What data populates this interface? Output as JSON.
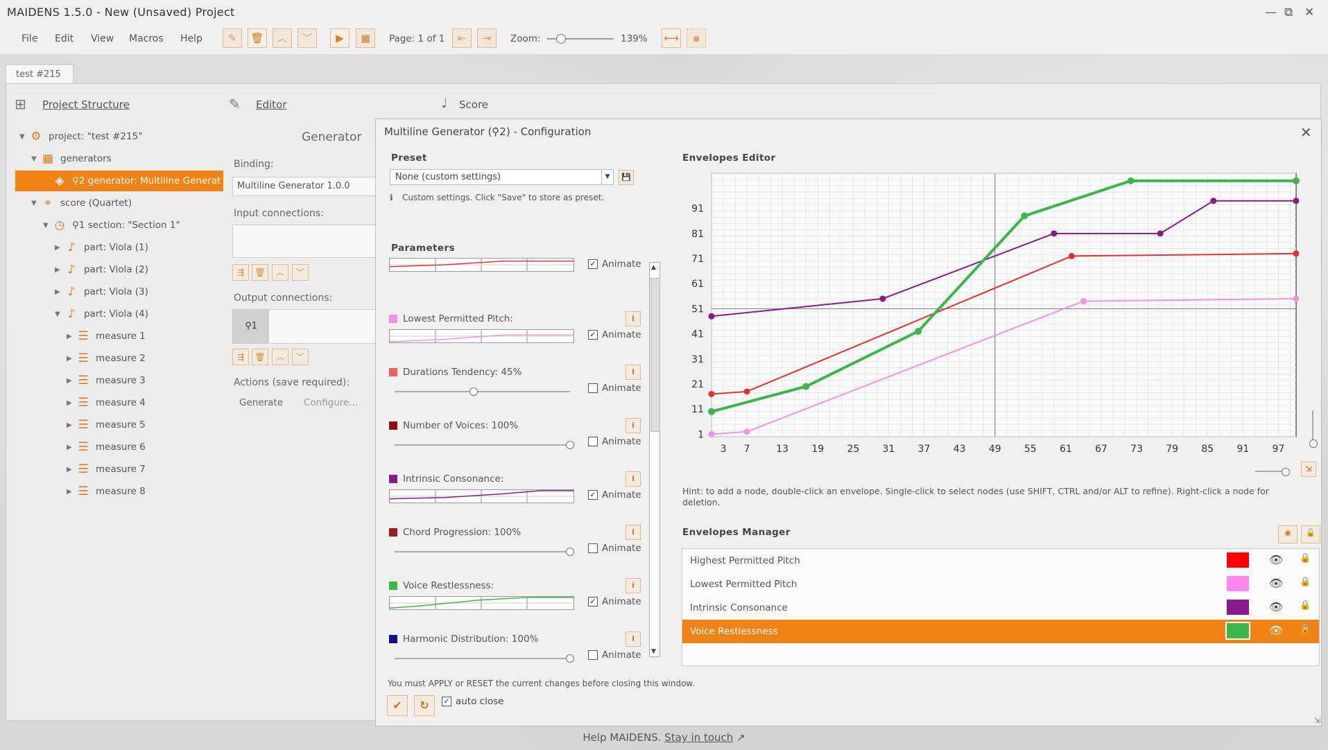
{
  "window": {
    "title": "MAIDENS 1.5.0 - New (Unsaved) Project"
  },
  "menu": [
    "File",
    "Edit",
    "View",
    "Macros",
    "Help"
  ],
  "toolbar": {
    "page_label": "Page: 1 of 1",
    "zoom_label": "Zoom:",
    "zoom_value": "139%",
    "zoom_level": 0.2
  },
  "tab": {
    "label": "test #215"
  },
  "panels": {
    "project_structure": "Project Structure",
    "editor": "Editor",
    "score": "Score"
  },
  "tree": [
    {
      "label": "project: \"test #215\"",
      "icon": "project-icon",
      "level": 0,
      "expand": "▼"
    },
    {
      "label": "generators",
      "icon": "generators-icon",
      "level": 1,
      "expand": "▼"
    },
    {
      "label": "⚲2 generator: Multiline Generat",
      "icon": "generator-icon",
      "level": 2,
      "expand": "",
      "selected": true
    },
    {
      "label": "score (Quartet)",
      "icon": "score-icon",
      "level": 1,
      "expand": "▼"
    },
    {
      "label": "⚲1 section: \"Section 1\"",
      "icon": "section-icon",
      "level": 2,
      "expand": "▼"
    },
    {
      "label": "part: Viola (1)",
      "icon": "viola-icon",
      "level": 3,
      "expand": "▶"
    },
    {
      "label": "part: Viola (2)",
      "icon": "viola-icon",
      "level": 3,
      "expand": "▶"
    },
    {
      "label": "part: Viola (3)",
      "icon": "viola-icon",
      "level": 3,
      "expand": "▶"
    },
    {
      "label": "part: Viola (4)",
      "icon": "viola-icon",
      "level": 3,
      "expand": "▼"
    },
    {
      "label": "measure 1",
      "icon": "measure-icon",
      "level": 4,
      "expand": "▶"
    },
    {
      "label": "measure 2",
      "icon": "measure-icon",
      "level": 4,
      "expand": "▶"
    },
    {
      "label": "measure 3",
      "icon": "measure-icon",
      "level": 4,
      "expand": "▶"
    },
    {
      "label": "measure 4",
      "icon": "measure-icon",
      "level": 4,
      "expand": "▶"
    },
    {
      "label": "measure 5",
      "icon": "measure-icon",
      "level": 4,
      "expand": "▶"
    },
    {
      "label": "measure 6",
      "icon": "measure-icon",
      "level": 4,
      "expand": "▶"
    },
    {
      "label": "measure 7",
      "icon": "measure-icon",
      "level": 4,
      "expand": "▶"
    },
    {
      "label": "measure 8",
      "icon": "measure-icon",
      "level": 4,
      "expand": "▶"
    }
  ],
  "generator": {
    "title": "Generator",
    "binding_label": "Binding:",
    "binding_value": "Multiline Generator 1.0.0",
    "input_label": "Input connections:",
    "output_label": "Output connections:",
    "output_item": "⚲1",
    "actions_label": "Actions (save required):",
    "generate": "Generate",
    "configure": "Configure..."
  },
  "dialog": {
    "title": "Multiline Generator (⚲2) - Configuration",
    "preset_heading": "Preset",
    "preset_value": "None (custom settings)",
    "preset_hint": "Custom settings. Click \"Save\" to store as preset.",
    "parameters_heading": "Parameters",
    "animate_label": "Animate",
    "envelopes_editor_heading": "Envelopes Editor",
    "editor_hint": "Hint: to add a node, double-click an envelope. Single-click to select nodes (use SHIFT, CTRL and/or ALT to refine). Right-click a node for deletion.",
    "envelopes_manager_heading": "Envelopes Manager",
    "apply_warning": "You must APPLY or RESET the current changes before closing this window.",
    "auto_close": "auto close"
  },
  "parameters": [
    {
      "label": "",
      "color": "",
      "kind": "envelope",
      "env_color": "#e83030",
      "animate": true
    },
    {
      "label": "Lowest Permitted Pitch:",
      "color": "#f590e6",
      "kind": "envelope",
      "env_color": "#f590e6",
      "animate": true
    },
    {
      "label": "Durations Tendency:   45%",
      "color": "#f46060",
      "kind": "slider",
      "value": 0.45,
      "animate": false
    },
    {
      "label": "Number of Voices:   100%",
      "color": "#8b1010",
      "kind": "slider",
      "value": 1.0,
      "animate": false
    },
    {
      "label": "Intrinsic Consonance:",
      "color": "#8a1a8a",
      "kind": "envelope",
      "env_color": "#8a1a8a",
      "animate": true
    },
    {
      "label": "Chord Progression:   100%",
      "color": "#a01818",
      "kind": "slider",
      "value": 1.0,
      "animate": false
    },
    {
      "label": "Voice Restlessness:",
      "color": "#3cb54a",
      "kind": "envelope",
      "env_color": "#3cb54a",
      "animate": true
    },
    {
      "label": "Harmonic Distribution:   100%",
      "color": "#101080",
      "kind": "slider",
      "value": 1.0,
      "animate": false
    }
  ],
  "chart_data": {
    "type": "line",
    "title": "",
    "xlabel": "",
    "ylabel": "",
    "xlim": [
      1,
      100
    ],
    "ylim": [
      0,
      105
    ],
    "x_ticks": [
      3,
      7,
      13,
      19,
      25,
      31,
      37,
      43,
      49,
      55,
      61,
      67,
      73,
      79,
      85,
      91,
      97
    ],
    "y_ticks": [
      1,
      11,
      21,
      31,
      41,
      51,
      61,
      71,
      81,
      91
    ],
    "grid": true,
    "crosshair": {
      "x": 49,
      "y": 51
    },
    "series": [
      {
        "name": "Highest Permitted Pitch",
        "color": "#e83030",
        "width": 2,
        "points": [
          [
            1,
            17
          ],
          [
            7,
            18
          ],
          [
            62,
            72
          ],
          [
            100,
            73
          ]
        ]
      },
      {
        "name": "Lowest Permitted Pitch",
        "color": "#f590e6",
        "width": 2,
        "points": [
          [
            1,
            1
          ],
          [
            7,
            2
          ],
          [
            64,
            54
          ],
          [
            100,
            55
          ]
        ]
      },
      {
        "name": "Intrinsic Consonance",
        "color": "#8a1a8a",
        "width": 2,
        "points": [
          [
            1,
            48
          ],
          [
            30,
            55
          ],
          [
            59,
            81
          ],
          [
            77,
            81
          ],
          [
            86,
            94
          ],
          [
            100,
            94
          ]
        ]
      },
      {
        "name": "Voice Restlessness",
        "color": "#3cb54a",
        "width": 4,
        "points": [
          [
            1,
            10
          ],
          [
            17,
            20
          ],
          [
            36,
            42
          ],
          [
            54,
            88
          ],
          [
            72,
            102
          ],
          [
            100,
            102
          ]
        ]
      }
    ]
  },
  "envelopes": [
    {
      "name": "Highest Permitted Pitch",
      "color": "#ff0000",
      "selected": false
    },
    {
      "name": "Lowest Permitted Pitch",
      "color": "#ff88f0",
      "selected": false
    },
    {
      "name": "Intrinsic Consonance",
      "color": "#8a1a8a",
      "selected": false
    },
    {
      "name": "Voice Restlessness",
      "color": "#3cb54a",
      "selected": true
    }
  ],
  "footer": {
    "help": "Help MAIDENS.",
    "link": "Stay in touch"
  }
}
